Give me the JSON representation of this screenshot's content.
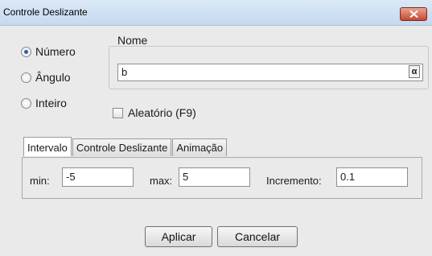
{
  "window": {
    "title": "Controle Deslizante"
  },
  "type_options": [
    {
      "label": "Número",
      "checked": true
    },
    {
      "label": "Ângulo",
      "checked": false
    },
    {
      "label": "Inteiro",
      "checked": false
    }
  ],
  "name": {
    "label": "Nome",
    "value": "b",
    "alpha_button": "α"
  },
  "random": {
    "label": "Aleatório (F9)",
    "checked": false
  },
  "tabs": [
    {
      "label": "Intervalo",
      "active": true
    },
    {
      "label": "Controle Deslizante",
      "active": false
    },
    {
      "label": "Animação",
      "active": false
    }
  ],
  "interval": {
    "min_label": "min:",
    "min_value": "-5",
    "max_label": "max:",
    "max_value": "5",
    "increment_label": "Incremento:",
    "increment_value": "0.1"
  },
  "buttons": {
    "apply": "Aplicar",
    "cancel": "Cancelar"
  },
  "colors": {
    "titlebar": "#c5d9ef",
    "close_button": "#c8472f",
    "dialog_bg": "#eaeaea"
  }
}
